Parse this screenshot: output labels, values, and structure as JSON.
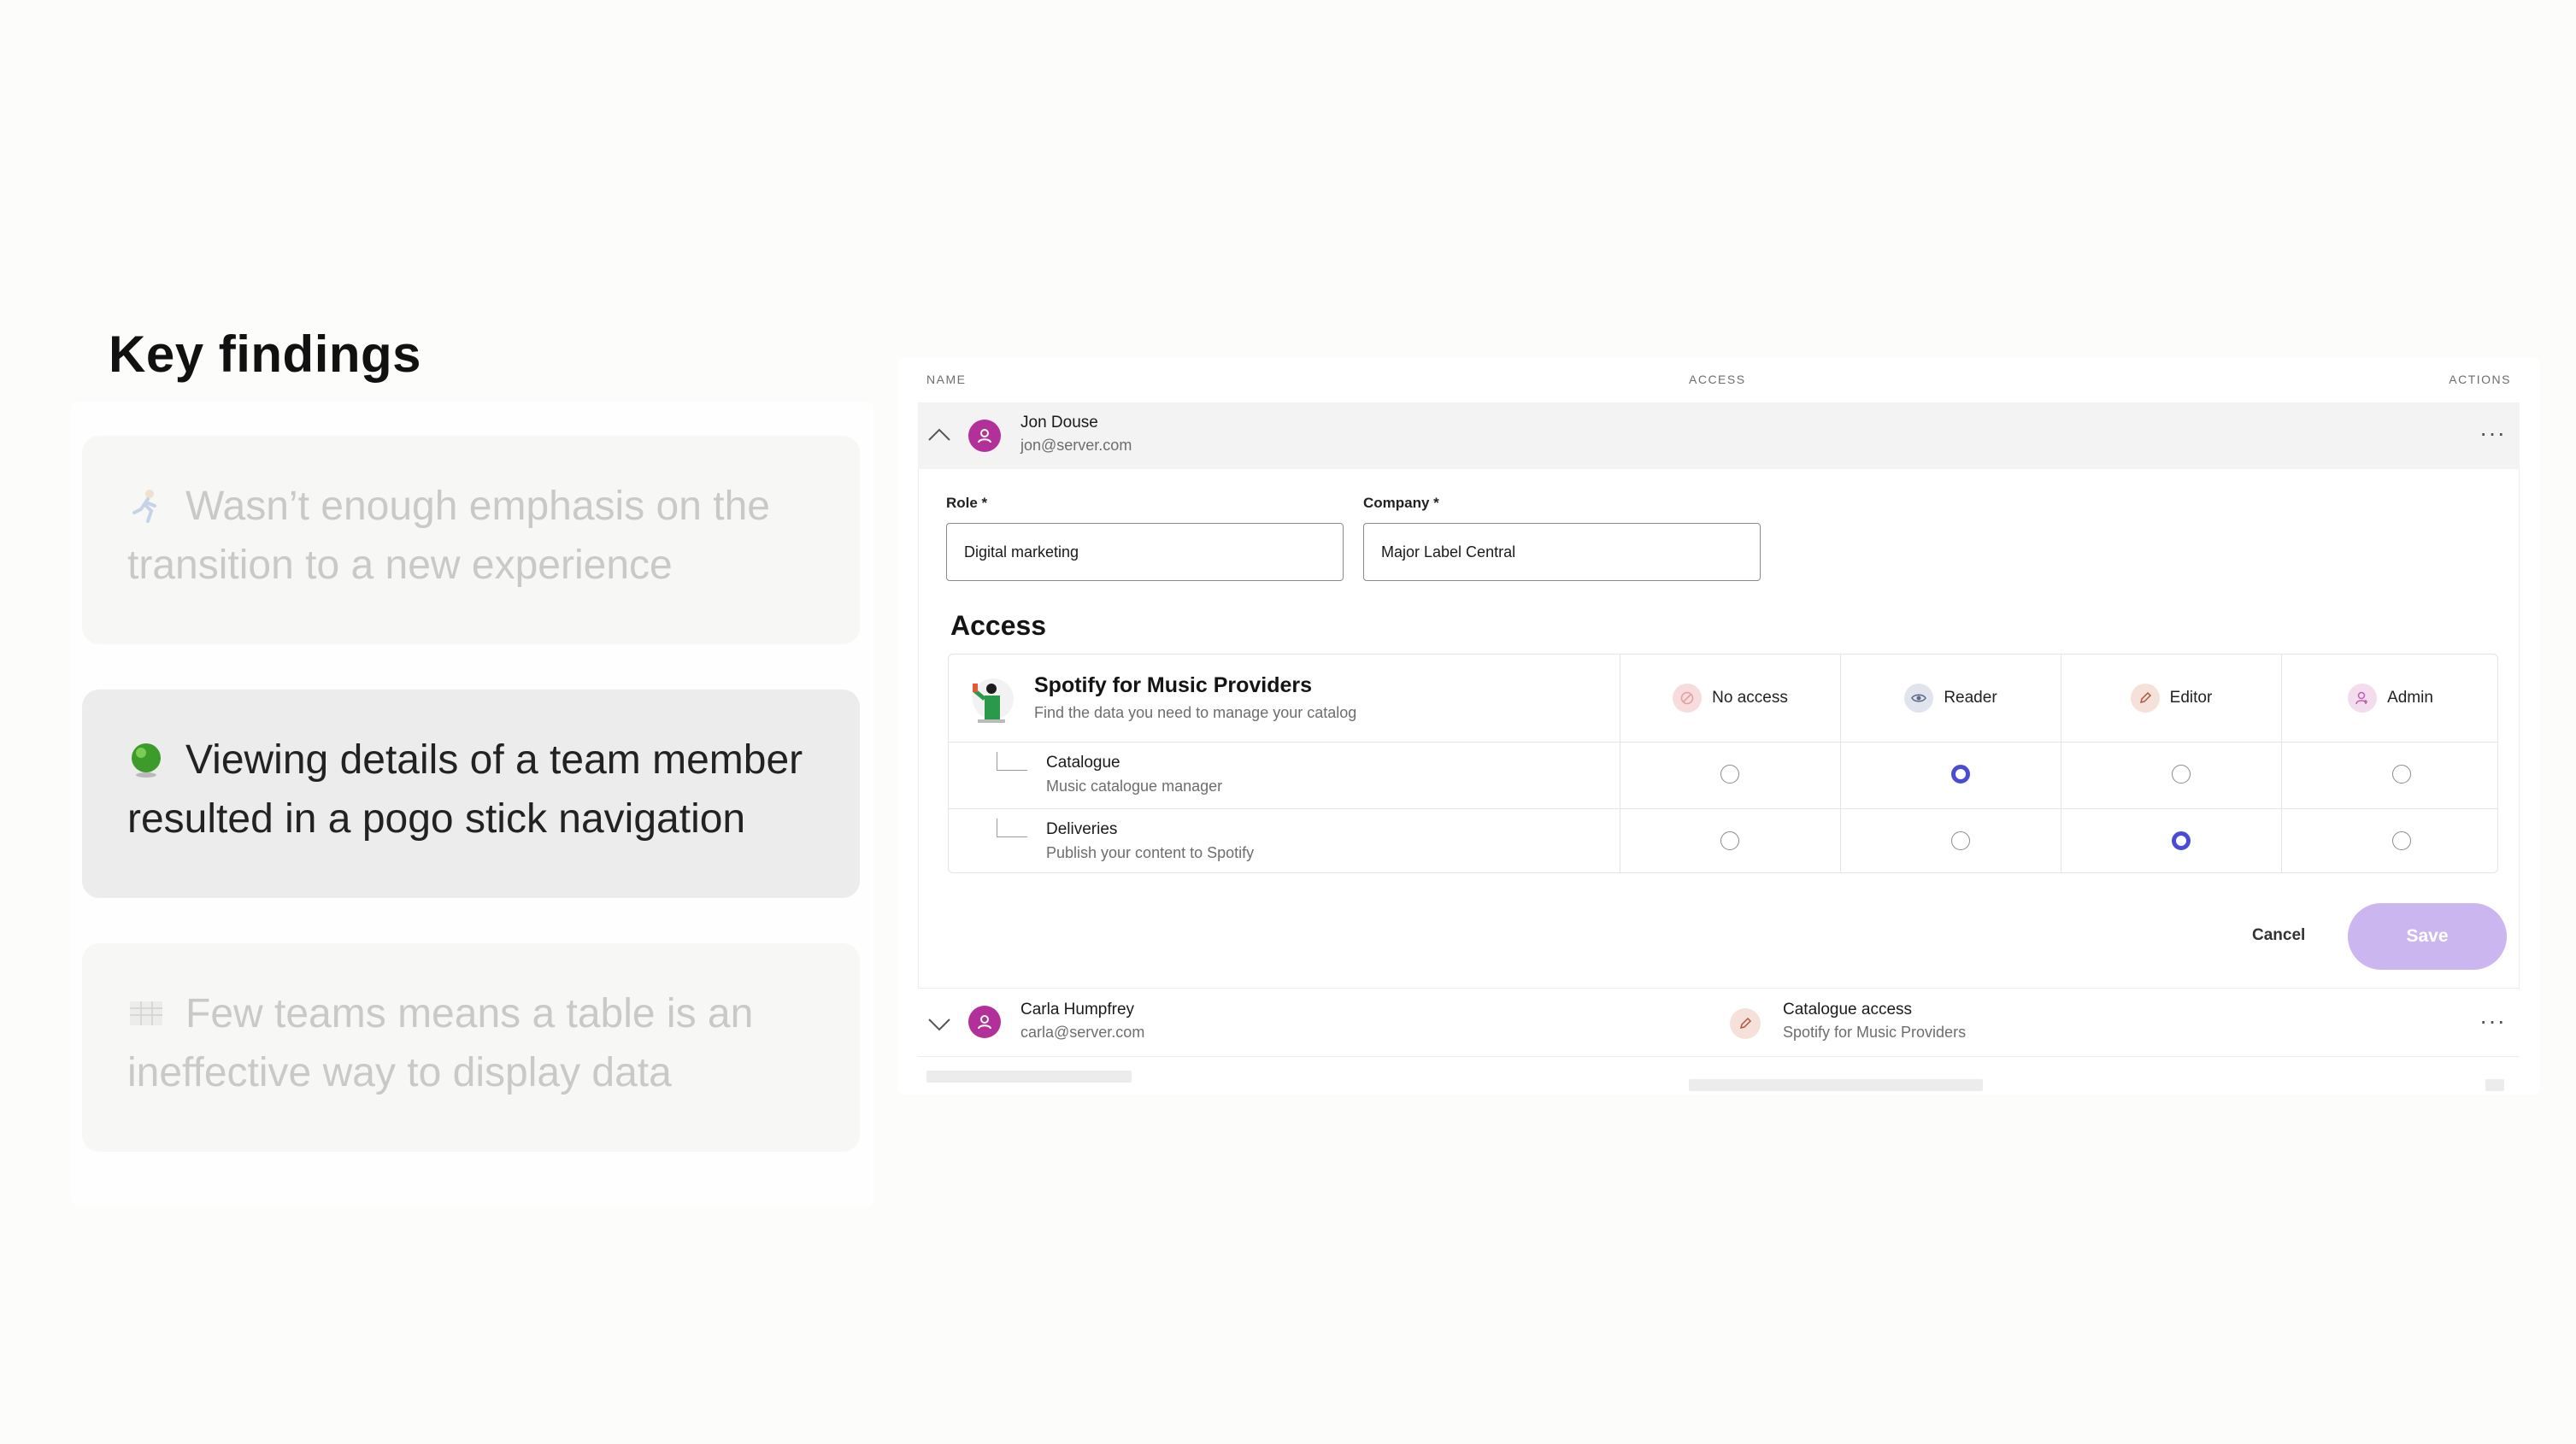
{
  "slide": {
    "title": "Key findings",
    "findings": [
      {
        "icon": "runner-emoji-icon",
        "text": "Wasn’t enough emphasis on the transition to a new experience",
        "state": "dimmed"
      },
      {
        "icon": "green-ball-emoji-icon",
        "text": "Viewing details of a team member resulted in a pogo stick navigation",
        "state": "active"
      },
      {
        "icon": "table-emoji-icon",
        "text": "Few teams means a table is an ineffective way to display data",
        "state": "dimmed"
      }
    ]
  },
  "table": {
    "headers": {
      "name": "NAME",
      "access": "ACCESS",
      "actions": "ACTIONS"
    },
    "expanded_row": {
      "name": "Jon Douse",
      "email": "jon@server.com",
      "role_label": "Role *",
      "role_value": "Digital marketing",
      "company_label": "Company *",
      "company_value": "Major Label Central",
      "access_title": "Access",
      "product": {
        "title": "Spotify for Music Providers",
        "subtitle": "Find the data you need to manage your catalog"
      },
      "levels": [
        {
          "label": "No access",
          "icon": "no-access-icon",
          "color": "#f6dcdc"
        },
        {
          "label": "Reader",
          "icon": "eye-icon",
          "color": "#e1e4ec"
        },
        {
          "label": "Editor",
          "icon": "pencil-icon",
          "color": "#f6e1da"
        },
        {
          "label": "Admin",
          "icon": "admin-user-icon",
          "color": "#f4dcef"
        }
      ],
      "sub_items": [
        {
          "title": "Catalogue",
          "desc": "Music catalogue manager",
          "selected": "Reader"
        },
        {
          "title": "Deliveries",
          "desc": "Publish your content to Spotify",
          "selected": "Editor"
        }
      ],
      "cancel_label": "Cancel",
      "save_label": "Save"
    },
    "collapsed_row": {
      "name": "Carla Humpfrey",
      "email": "carla@server.com",
      "access_title": "Catalogue access",
      "access_sub": "Spotify for Music Providers"
    },
    "kebab": "···",
    "colors": {
      "accent": "#4b4cd6",
      "avatar": "#b32f9a",
      "save_disabled": "#cbb6f0"
    }
  }
}
